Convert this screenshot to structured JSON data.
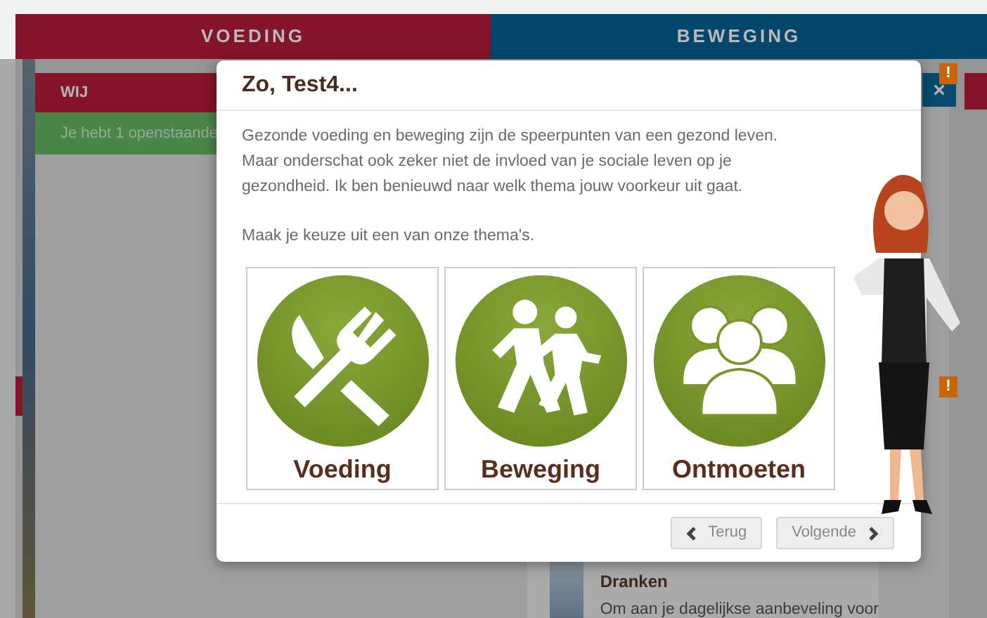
{
  "tabs": [
    {
      "label": "VOEDING",
      "color": "#85142a"
    },
    {
      "label": "BEWEGING",
      "color": "#03476b"
    }
  ],
  "background": {
    "panel_title": "WIJ",
    "notice": "Je hebt 1 openstaande",
    "close_symbol": "×",
    "alert_badges": [
      "!",
      "!"
    ],
    "article": {
      "title": "Dranken",
      "text": "Om aan je dagelijkse aanbeveling voor"
    }
  },
  "dialog": {
    "title": "Zo, Test4...",
    "paragraphs": [
      "Gezonde voeding en beweging zijn de speerpunten van een gezond leven. Maar onderschat ook zeker niet de invloed van je sociale leven op je gezondheid. Ik ben benieuwd naar welk thema jouw voorkeur uit gaat.",
      "Maak je keuze uit een van onze thema's."
    ],
    "themes": [
      {
        "kind": "food",
        "label": "Voeding"
      },
      {
        "kind": "exercise",
        "label": "Beweging"
      },
      {
        "kind": "meet",
        "label": "Ontmoeten"
      }
    ],
    "buttons": [
      {
        "kind": "back",
        "label": "Terug"
      },
      {
        "kind": "next",
        "label": "Volgende"
      }
    ]
  }
}
